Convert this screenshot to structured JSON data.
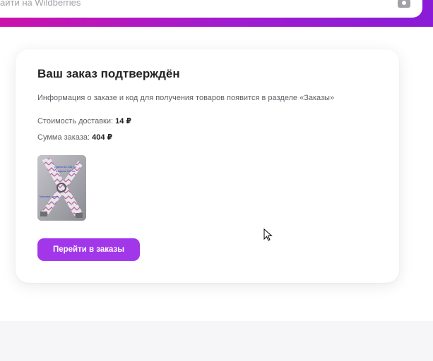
{
  "header": {
    "search_placeholder": "айти на Wildberries"
  },
  "order": {
    "title": "Ваш заказ подтверждён",
    "info": "Информация о заказе и код для получения товаров появится в разделе «Заказы»",
    "delivery_label": "Стоимость доставки: ",
    "delivery_value": "14 ₽",
    "sum_label": "Сумма заказа: ",
    "sum_value": "404 ₽",
    "product_image_text_top": "Длина 60-130 см",
    "product_image_text_mid": "Ширина 3,8 см",
    "product_image_text_low": "Мультиф. цвета",
    "go_to_orders_label": "Перейти в заказы"
  },
  "colors": {
    "brand_gradient_start": "#cb11ab",
    "brand_gradient_end": "#8a1bd6",
    "button": "#a237ea"
  }
}
